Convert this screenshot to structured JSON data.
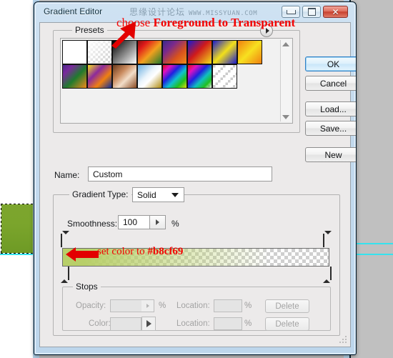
{
  "window": {
    "title": "Gradient Editor",
    "watermark_cn": "思缘设计论坛",
    "watermark_en": "WWW.MISSYUAN.COM",
    "controls": {
      "minimize": "minimize-icon",
      "maximize": "maximize-icon",
      "close": "✕"
    }
  },
  "annotations": {
    "top_prefix": "choose ",
    "top_bold": "Foreground to Transparent",
    "bottom_prefix": "set color to ",
    "bottom_bold": "#b8cf69",
    "accent_color": "#f40000"
  },
  "presets": {
    "legend": "Presets",
    "flyout_icon": "flyout-arrow-icon",
    "scroll_up_icon": "scroll-up-icon",
    "scroll_down_icon": "scroll-down-icon",
    "swatches": [
      {
        "name": "foreground-to-background",
        "css": "linear-gradient(135deg,#ffffff 0%,#ffffff 100%)"
      },
      {
        "name": "foreground-to-transparent",
        "css": "linear-gradient(135deg,#ffffff 0%,rgba(255,255,255,0) 100%), repeating-conic-gradient(#ffffff 0% 25%, #cccccc 0% 50%) 0 0/7px 7px"
      },
      {
        "name": "black-white",
        "css": "linear-gradient(135deg,#000000 0%,#ffffff 100%)"
      },
      {
        "name": "red-green",
        "css": "linear-gradient(135deg,#8c1010 0%,#e01a1a 22%,#f2a01e 55%,#1f7a2e 100%)"
      },
      {
        "name": "violet-orange",
        "css": "linear-gradient(135deg,#3b2a8c 0%,#7a2a8c 30%,#d8521c 65%,#f08a1a 100%)"
      },
      {
        "name": "blue-red-yellow",
        "css": "linear-gradient(135deg,#1a1ad0 0%,#d01a1a 45%,#f2e01a 100%)"
      },
      {
        "name": "blue-yellow-blue",
        "css": "linear-gradient(135deg,#1a1ad0 0%,#f2e01a 50%,#1a1ad0 100%)"
      },
      {
        "name": "orange-yellow-orange",
        "css": "linear-gradient(135deg,#f08010 0%,#f7e020 50%,#f08010 100%)"
      },
      {
        "name": "violet-green-orange",
        "css": "linear-gradient(135deg,#4a2a8c 0%,#7a2a9c 22%,#1f7a2e 55%,#f08a1a 100%)"
      },
      {
        "name": "yellow-violet-orange-blue",
        "css": "linear-gradient(135deg,#f7e020 0%,#8c2a9c 35%,#f08010 65%,#10309c 100%)"
      },
      {
        "name": "copper",
        "css": "linear-gradient(135deg,#6b3a1c 0%,#c98a5e 35%,#f2ddc8 60%,#8a4a22 100%)"
      },
      {
        "name": "chrome",
        "css": "linear-gradient(135deg,#6aaee0 0%,#eaf4fb 42%,#ffffff 58%,#b08c10 100%)"
      },
      {
        "name": "spectrum",
        "css": "linear-gradient(135deg,#e01010 0%,#e010c0 18%,#2020e0 38%,#10c0d0 58%,#20c020 78%,#e0e010 100%)"
      },
      {
        "name": "transparent-rainbow",
        "css": "linear-gradient(135deg,#e01010 0%,#e010c0 20%,#2020e0 42%,#10c0c0 62%,#20c020 82%,rgba(255,255,255,0) 100%), repeating-conic-gradient(#ffffff 0% 25%, #cccccc 0% 50%) 0 0/7px 7px"
      },
      {
        "name": "transparent-stripes",
        "css": "repeating-linear-gradient(135deg,rgba(255,255,255,0) 0 5px,#ffffff 5px 10px), repeating-conic-gradient(#ffffff 0% 25%, #cccccc 0% 50%) 0 0/7px 7px"
      }
    ]
  },
  "buttons": {
    "ok": "OK",
    "cancel": "Cancel",
    "load": "Load...",
    "save": "Save...",
    "new": "New"
  },
  "name_row": {
    "label": "Name:",
    "value": "Custom"
  },
  "gradient_type": {
    "legend": "Gradient Type:",
    "selected": "Solid",
    "caret_icon": "chevron-down-icon"
  },
  "smoothness": {
    "label": "Smoothness:",
    "value": "100",
    "unit": "%",
    "stepper_icon": "stepper-arrow-icon"
  },
  "gradient_bar": {
    "start_color": "#b8cf69",
    "end_color": "transparent",
    "left_opacity_stop": "#2a2a2a",
    "right_opacity_stop": "#ffffff",
    "left_color_stop": "#b8cf69",
    "right_color_stop": "#ffffff"
  },
  "stops": {
    "legend": "Stops",
    "opacity_label": "Opacity:",
    "opacity_value": "",
    "opacity_unit": "%",
    "opacity_location_label": "Location:",
    "opacity_location_value": "",
    "opacity_location_unit": "%",
    "opacity_delete": "Delete",
    "color_label": "Color:",
    "color_value": "",
    "color_location_label": "Location:",
    "color_location_value": "",
    "color_location_unit": "%",
    "color_delete": "Delete"
  },
  "canvas": {
    "shape_color": "#7ba52c",
    "guide_color": "#35e3ee"
  }
}
